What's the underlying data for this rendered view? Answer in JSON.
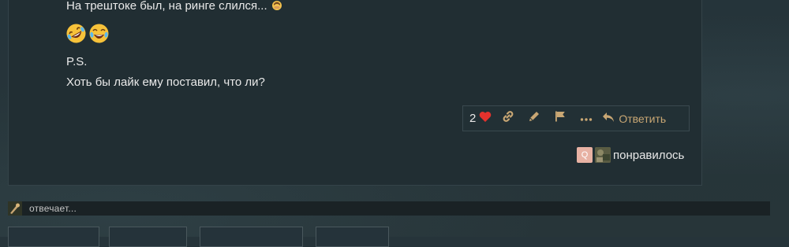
{
  "post": {
    "line1": "На трештоке был, на ринге слился...",
    "ps": "P.S.",
    "question": "Хоть бы лайк ему поставил, что ли?"
  },
  "actions": {
    "like_count": "2",
    "reply_label": "Ответить"
  },
  "likers": {
    "first_avatar_letter": "Q",
    "label": "понравилось"
  },
  "typing": {
    "label": "отвечает..."
  },
  "colors": {
    "accent": "#c9a774",
    "heart": "#e5322d",
    "card_bg": "#212e33",
    "page_bg": "#26343a"
  },
  "icons": {
    "emoji_inline": "man-facepalming-emoji",
    "emoji_row": [
      "rolling-on-floor-laughing-emoji",
      "tears-of-joy-emoji"
    ],
    "actions": [
      "heart-icon",
      "link-icon",
      "pencil-icon",
      "flag-icon",
      "ellipsis-icon",
      "reply-icon"
    ]
  }
}
